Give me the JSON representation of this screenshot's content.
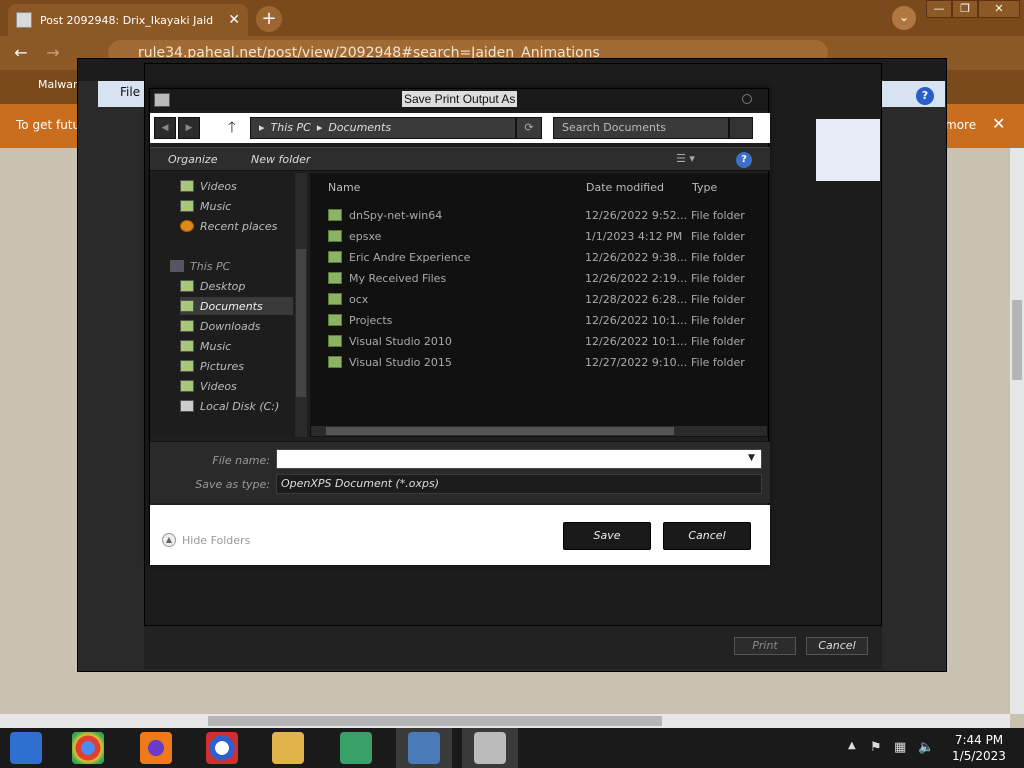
{
  "browser": {
    "tab_title": "Post 2092948: Drix_Ikayaki Jaid",
    "tab_close": "✕",
    "new_tab": "+",
    "tab_menu": "⌄",
    "url": "rule34.paheal.net/post/view/2092948#search=Jaiden_Animations",
    "bookmark": "Malwar",
    "info_left": "To get futu",
    "info_right": "more",
    "info_close": "✕",
    "back": "←",
    "forward": "→",
    "window_minimize": "—",
    "window_maximize": "❐",
    "window_close": "✕"
  },
  "print_window": {
    "file_menu": "File",
    "help": "?",
    "print_label": "Print",
    "cancel_label": "Cancel"
  },
  "dialog": {
    "title": "Save Print Output As",
    "back": "◀",
    "forward": "▶",
    "up": "🡑",
    "breadcrumb": [
      "This PC",
      "Documents"
    ],
    "breadcrumb_sep": "▸",
    "refresh": "⟳",
    "search_placeholder": "Search Documents",
    "organize": "Organize",
    "new_folder": "New folder",
    "view_icon": "☰ ▾",
    "help": "?",
    "nav_items": [
      {
        "label": "Videos",
        "icon": "folder"
      },
      {
        "label": "Music",
        "icon": "folder"
      },
      {
        "label": "Recent places",
        "icon": "recent"
      },
      {
        "label": "This PC",
        "icon": "pc"
      },
      {
        "label": "Desktop",
        "icon": "folder"
      },
      {
        "label": "Documents",
        "icon": "folder"
      },
      {
        "label": "Downloads",
        "icon": "folder"
      },
      {
        "label": "Music",
        "icon": "folder"
      },
      {
        "label": "Pictures",
        "icon": "folder"
      },
      {
        "label": "Videos",
        "icon": "folder"
      },
      {
        "label": "Local Disk (C:)",
        "icon": "disk"
      }
    ],
    "columns": {
      "name": "Name",
      "date": "Date modified",
      "type": "Type"
    },
    "files": [
      {
        "name": "dnSpy-net-win64",
        "date": "12/26/2022 9:52...",
        "type": "File folder"
      },
      {
        "name": "epsxe",
        "date": "1/1/2023 4:12 PM",
        "type": "File folder"
      },
      {
        "name": "Eric Andre Experience",
        "date": "12/26/2022 9:38...",
        "type": "File folder"
      },
      {
        "name": "My Received Files",
        "date": "12/26/2022 2:19...",
        "type": "File folder"
      },
      {
        "name": "ocx",
        "date": "12/28/2022 6:28...",
        "type": "File folder"
      },
      {
        "name": "Projects",
        "date": "12/26/2022 10:1...",
        "type": "File folder"
      },
      {
        "name": "Visual Studio 2010",
        "date": "12/26/2022 10:1...",
        "type": "File folder"
      },
      {
        "name": "Visual Studio 2015",
        "date": "12/27/2022 9:10...",
        "type": "File folder"
      }
    ],
    "file_name_label": "File name:",
    "file_name_value": "",
    "save_type_label": "Save as type:",
    "save_type_value": "OpenXPS Document (*.oxps)",
    "hide_folders": "Hide Folders",
    "save": "Save",
    "cancel": "Cancel"
  },
  "taskbar": {
    "time": "7:44 PM",
    "date": "1/5/2023",
    "tray_arrow": "▲"
  },
  "colors": {
    "browser_brown": "#8c5825",
    "info_orange": "#c86e1e",
    "dialog_dark": "#1f1f1f",
    "folder_green": "#8db464"
  }
}
